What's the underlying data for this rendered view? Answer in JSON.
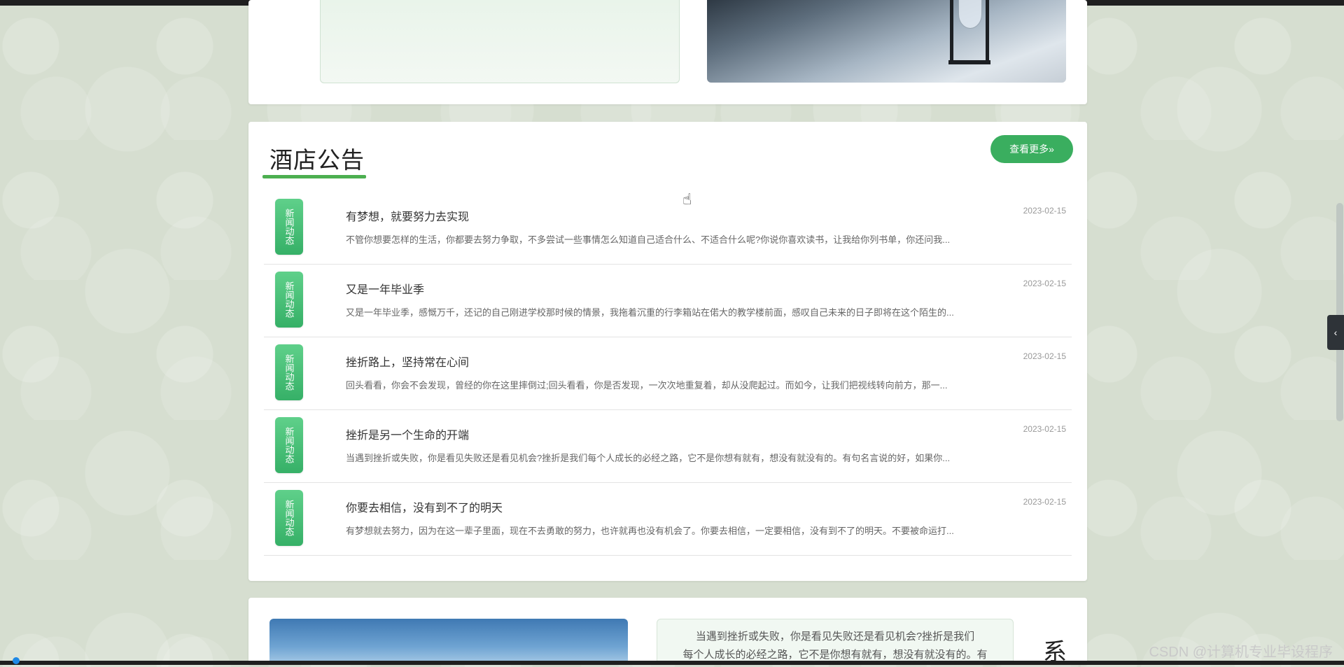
{
  "news_section": {
    "title": "酒店公告",
    "more_label": "查看更多»",
    "badge_label": "新闻动态",
    "items": [
      {
        "title": "有梦想，就要努力去实现",
        "desc": "不管你想要怎样的生活，你都要去努力争取，不多尝试一些事情怎么知道自己适合什么、不适合什么呢?你说你喜欢读书，让我给你列书单，你还问我...",
        "date": "2023-02-15"
      },
      {
        "title": "又是一年毕业季",
        "desc": "又是一年毕业季，感慨万千，还记的自己刚进学校那时候的情景，我拖着沉重的行李箱站在偌大的教学楼前面，感叹自己未来的日子即将在这个陌生的...",
        "date": "2023-02-15"
      },
      {
        "title": "挫折路上，坚持常在心间",
        "desc": "回头看看，你会不会发现，曾经的你在这里摔倒过;回头看看，你是否发现，一次次地重复着，却从没爬起过。而如今，让我们把视线转向前方，那一...",
        "date": "2023-02-15"
      },
      {
        "title": "挫折是另一个生命的开端",
        "desc": "当遇到挫折或失败，你是看见失败还是看见机会?挫折是我们每个人成长的必经之路，它不是你想有就有，想没有就没有的。有句名言说的好，如果你...",
        "date": "2023-02-15"
      },
      {
        "title": "你要去相信，没有到不了的明天",
        "desc": "有梦想就去努力，因为在这一辈子里面，现在不去勇敢的努力，也许就再也没有机会了。你要去相信，一定要相信，没有到不了的明天。不要被命运打...",
        "date": "2023-02-15"
      }
    ]
  },
  "bottom_section": {
    "text_line1": "当遇到挫折或失败，你是看见失败还是看见机会?挫折是我们",
    "text_line2": "每个人成长的必经之路，它不是你想有就有，想没有就没有的。有",
    "side_char": "系"
  },
  "side_toggle_label": "‹",
  "watermark": "CSDN @计算机专业毕设程序",
  "colors": {
    "accent": "#3aae5f",
    "underline": "#4caf50",
    "background": "#d6ded0"
  },
  "icons": {
    "cursor": "hand-pointer-icon",
    "toggle": "chevron-left-icon"
  }
}
